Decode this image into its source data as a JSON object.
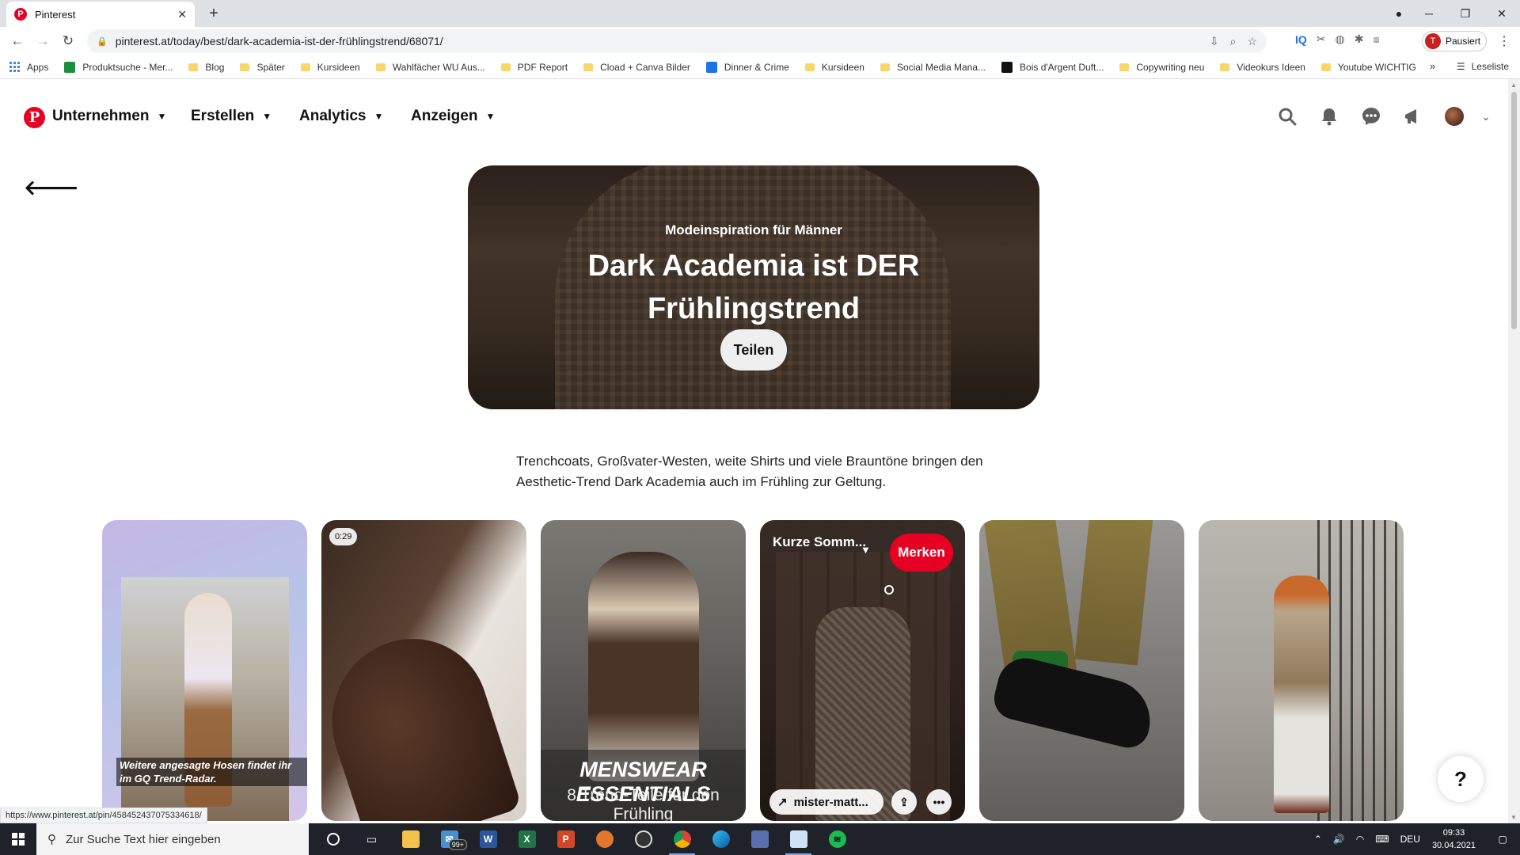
{
  "browser": {
    "tab_title": "Pinterest",
    "url": "pinterest.at/today/best/dark-academia-ist-der-frühlingstrend/68071/",
    "profile_initial": "T",
    "profile_status": "Pausiert",
    "bookmarks": [
      {
        "label": "Apps",
        "kind": "apps"
      },
      {
        "label": "Produktsuche - Mer...",
        "kind": "site",
        "color": "#1e8e3e"
      },
      {
        "label": "Blog",
        "kind": "folder"
      },
      {
        "label": "Später",
        "kind": "folder"
      },
      {
        "label": "Kursideen",
        "kind": "folder"
      },
      {
        "label": "Wahlfächer WU Aus...",
        "kind": "folder"
      },
      {
        "label": "PDF Report",
        "kind": "folder"
      },
      {
        "label": "Cload + Canva Bilder",
        "kind": "folder"
      },
      {
        "label": "Dinner & Crime",
        "kind": "site",
        "color": "#1a73e8"
      },
      {
        "label": "Kursideen",
        "kind": "folder"
      },
      {
        "label": "Social Media Mana...",
        "kind": "folder"
      },
      {
        "label": "Bois d'Argent Duft...",
        "kind": "site",
        "color": "#111111"
      },
      {
        "label": "Copywriting neu",
        "kind": "folder"
      },
      {
        "label": "Videokurs Ideen",
        "kind": "folder"
      },
      {
        "label": "Youtube WICHTIG",
        "kind": "folder"
      }
    ],
    "more_bookmarks": "»",
    "reading_list": "Leseliste",
    "status_url": "https://www.pinterest.at/pin/458452437075334618/"
  },
  "header": {
    "nav": [
      "Unternehmen",
      "Erstellen",
      "Analytics",
      "Anzeigen"
    ],
    "icons": [
      "search-icon",
      "bell-icon",
      "chat-icon",
      "megaphone-icon"
    ]
  },
  "hero": {
    "subtitle": "Modeinspiration für Männer",
    "title": "Dark Academia ist DER Frühlingstrend",
    "share_label": "Teilen"
  },
  "description": "Trenchcoats, Großvater-Westen, weite Shirts und viele Brauntöne bringen den Aesthetic-Trend Dark Academia auch im Frühling zur Geltung.",
  "pins": {
    "p1_caption": "Weitere angesagte Hosen findet ihr im GQ Trend-Radar.",
    "p2_duration": "0:29",
    "p3_title": "MENSWEAR ESSENTIALS",
    "p3_subtitle": "8 Trend-Teile für den Frühling",
    "p4_board": "Kurze Somm...",
    "p4_save": "Merken",
    "p4_link": "mister-matt..."
  },
  "help_label": "?",
  "taskbar": {
    "search_placeholder": "Zur Suche Text hier eingeben",
    "mail_badge": "99+",
    "language": "DEU",
    "time": "09:33",
    "date": "30.04.2021"
  },
  "colors": {
    "pinterest_red": "#e60023",
    "taskbar": "#1f2329"
  }
}
